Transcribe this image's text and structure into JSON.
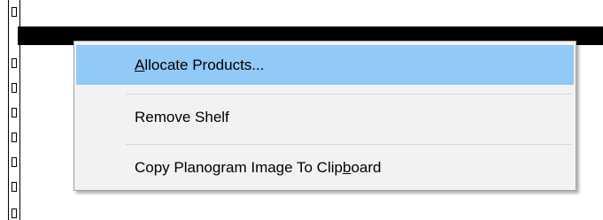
{
  "planogram": {
    "shelf_color": "#000000",
    "rail_color": "#000000"
  },
  "context_menu": {
    "highlight_color": "#91c9f7",
    "items": [
      {
        "label": "Allocate Products...",
        "label_parts": [
          "",
          "A",
          "llocate Products..."
        ],
        "highlighted": true
      },
      {
        "label": "Remove Shelf",
        "label_parts": [
          "Remove Shelf",
          "",
          ""
        ],
        "highlighted": false
      },
      {
        "label": "Copy Planogram Image To Clipboard",
        "label_parts": [
          "Copy Planogram Image To Clip",
          "b",
          "oard"
        ],
        "highlighted": false
      }
    ]
  }
}
